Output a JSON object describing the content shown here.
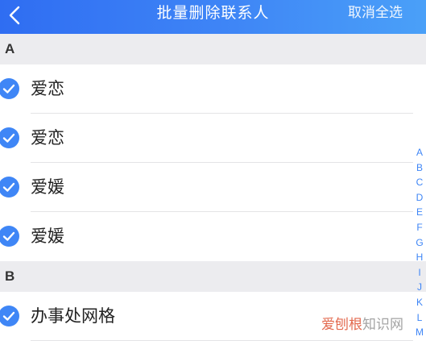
{
  "header": {
    "title": "批量删除联系人",
    "right_action": "取消全选",
    "back_icon": "chevron-left-icon"
  },
  "sections": [
    {
      "letter": "A",
      "items": [
        {
          "label": "爱恋",
          "checked": true
        },
        {
          "label": "爱恋",
          "checked": true
        },
        {
          "label": "爱媛",
          "checked": true
        },
        {
          "label": "爱媛",
          "checked": true
        }
      ]
    },
    {
      "letter": "B",
      "items": [
        {
          "label": "办事处网格",
          "checked": true
        }
      ]
    }
  ],
  "index_bar": [
    "A",
    "B",
    "C",
    "D",
    "E",
    "F",
    "G",
    "H",
    "I",
    "J",
    "K",
    "L",
    "M"
  ],
  "watermark": {
    "brand": "爱刨根",
    "suffix": "知识网"
  },
  "colors": {
    "accent": "#3f86f6",
    "header_start": "#2f6df2",
    "header_end": "#4aa0f8",
    "section_bg": "#ececef"
  }
}
